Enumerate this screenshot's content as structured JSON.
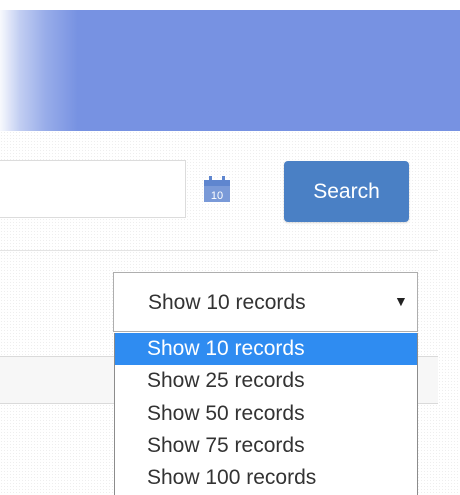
{
  "header": {
    "color": "#7792e2"
  },
  "filter": {
    "date_field_value": "",
    "calendar_icon_day": "10",
    "search_label": "Search",
    "search_color": "#4a80c5"
  },
  "records_select": {
    "selected_label": "Show 10 records",
    "caret": "▼",
    "highlight_color": "#2f8cf1",
    "options": [
      {
        "label": "Show 10 records",
        "selected": true
      },
      {
        "label": "Show 25 records",
        "selected": false
      },
      {
        "label": "Show 50 records",
        "selected": false
      },
      {
        "label": "Show 75 records",
        "selected": false
      },
      {
        "label": "Show 100 records",
        "selected": false
      }
    ]
  }
}
